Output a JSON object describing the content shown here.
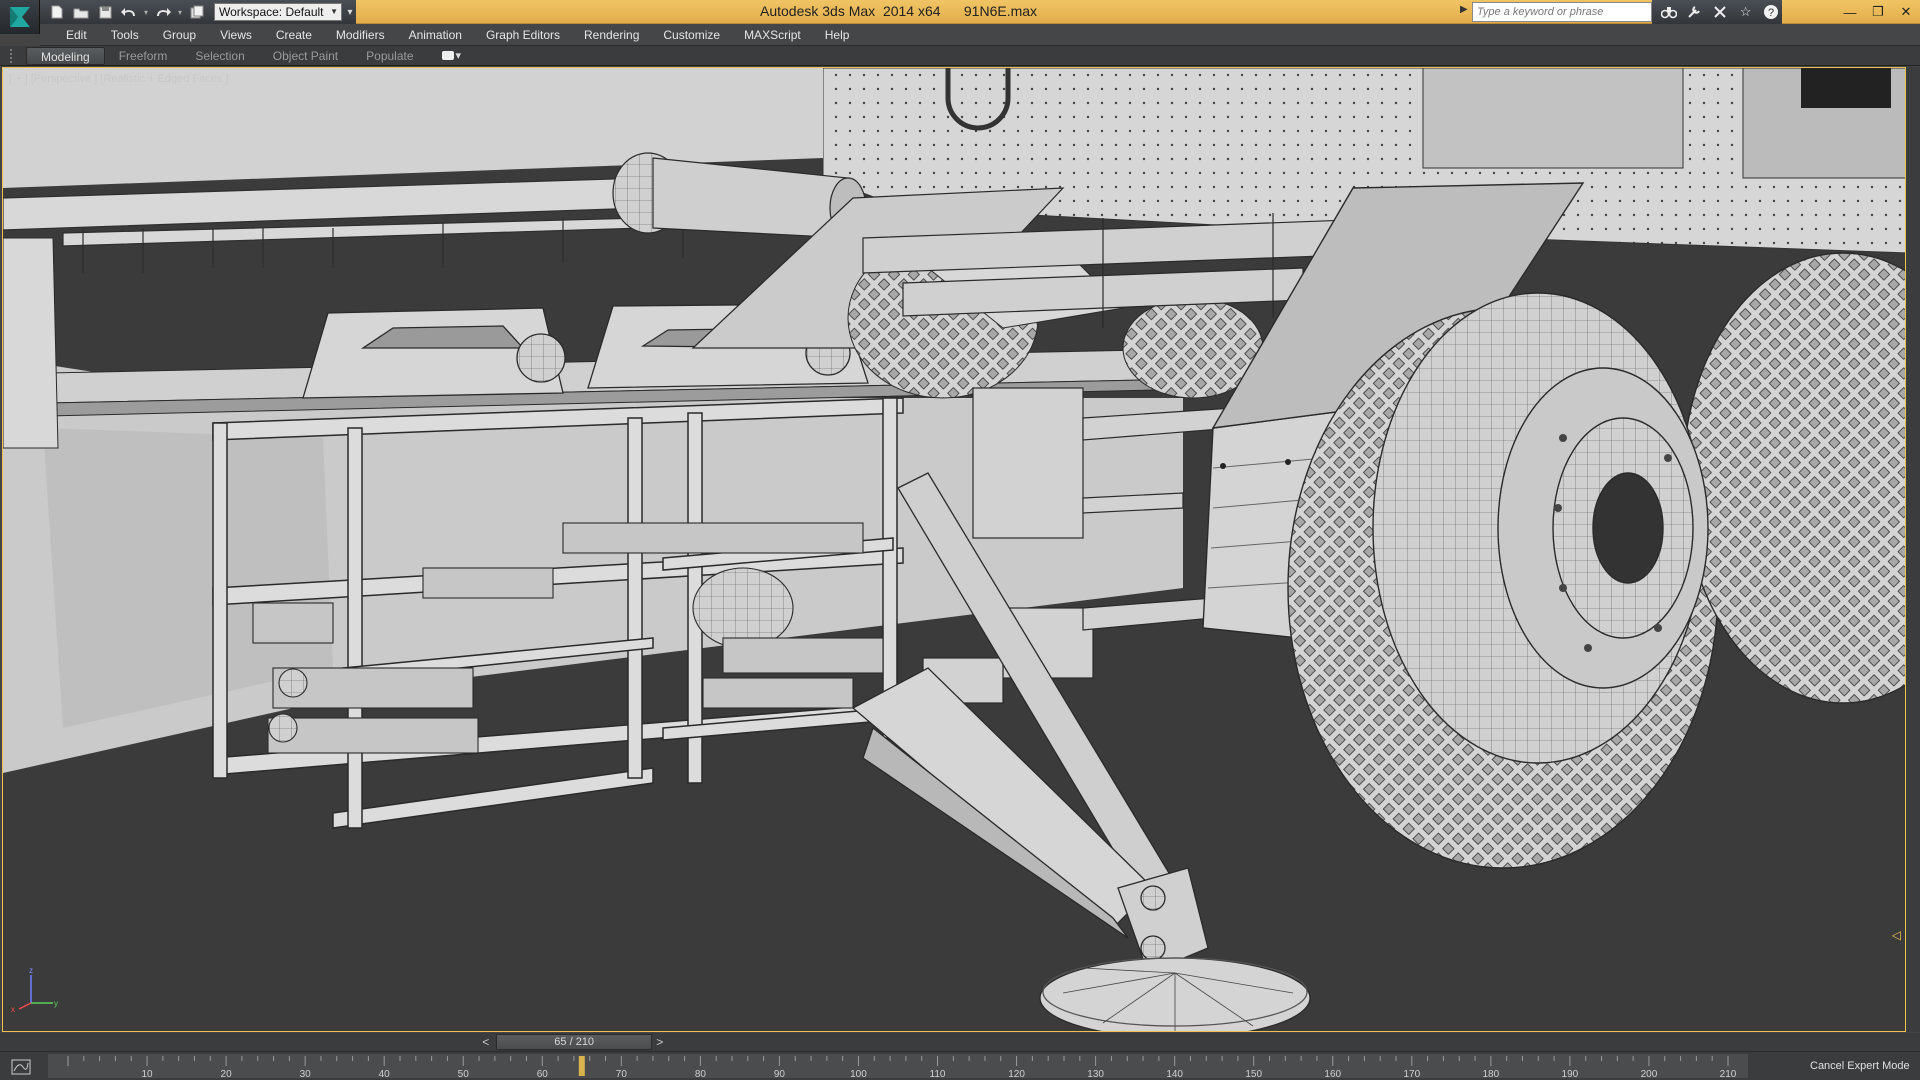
{
  "window": {
    "app_title": "Autodesk 3ds Max  2014 x64      91N6E.max",
    "workspace_label": "Workspace: Default",
    "search_placeholder": "Type a keyword or phrase"
  },
  "menubar": {
    "items": [
      "Edit",
      "Tools",
      "Group",
      "Views",
      "Create",
      "Modifiers",
      "Animation",
      "Graph Editors",
      "Rendering",
      "Customize",
      "MAXScript",
      "Help"
    ]
  },
  "ribbon": {
    "tabs": [
      "Modeling",
      "Freeform",
      "Selection",
      "Object Paint",
      "Populate"
    ],
    "active_tab": "Modeling"
  },
  "viewport": {
    "label": "[ + ] [Perspective ] [Realistic + Edged Faces ]",
    "axis_labels": {
      "x": "x",
      "y": "y",
      "z": "z"
    }
  },
  "timeslider": {
    "frame_display": "65 / 210",
    "prev_label": "<",
    "next_label": ">",
    "current_frame": 65,
    "total_frames": 210
  },
  "trackbar": {
    "tick_labels": [
      "10",
      "20",
      "30",
      "40",
      "50",
      "60",
      "70",
      "80",
      "90",
      "100",
      "110",
      "120",
      "130",
      "140",
      "150",
      "160",
      "170",
      "180",
      "190",
      "200",
      "210"
    ],
    "range_start": 0,
    "range_end": 210
  },
  "status": {
    "cancel_expert_label": "Cancel Expert Mode"
  },
  "colors": {
    "title_bar": "#e9b555",
    "viewport_border": "#f0c050",
    "viewport_bg": "#3b3b3b",
    "model_fill": "#cfcfcf",
    "wire": "#2a2a2a"
  }
}
